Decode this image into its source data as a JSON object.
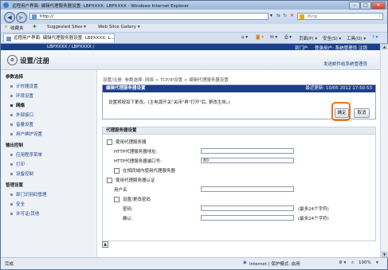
{
  "window": {
    "title": "远程用户界面: 编辑代理服务器设置: LBPXXXX: LBPXXXX - Windows Internet Explorer",
    "min": "–",
    "max": "□",
    "close": "✕"
  },
  "addressbar": {
    "url": "http://",
    "search_placeholder": "Bing"
  },
  "favorites": {
    "label": "收藏夹",
    "suggested": "Suggested Sites ▾",
    "gallery": "Web Slice Gallery ▾"
  },
  "tab": {
    "label": "远程用户界面: 编辑代理服务器设置: LBPXXXX: L..."
  },
  "commandbar": {
    "page": "页面(P) ▾",
    "safety": "安全(S) ▾",
    "tools": "工具(O) ▾"
  },
  "top": {
    "device": "LBPXXXX / LBPXXXX /",
    "portal": "到门户",
    "login": "登录用户: 系统管理员 注销"
  },
  "header": {
    "title": "设置/注册",
    "mail": "发送邮件给系统管理员"
  },
  "sidebar": {
    "sections": [
      {
        "title": "参数选择",
        "items": [
          "计时器设置",
          "环境设置",
          "网络",
          "外部接口",
          "音量设置",
          "用户维护设置"
        ]
      },
      {
        "title": "输出控制",
        "items": [
          "应用程序菜单",
          "打印",
          "设备控制"
        ]
      },
      {
        "title": "管理设置",
        "items": [
          "部门识别码管理",
          "安全",
          "许可证/其他"
        ]
      }
    ],
    "current": "网络"
  },
  "breadcrumb": "设置/注册: 参数选择: 网络 > TCP/IP设置 > 编辑代理服务器设置",
  "dialog": {
    "title": "编辑代理服务器设置",
    "updated": "最近更新: 10/05 2012 17:50:53",
    "note": "设置将按如下更改。(主电源开关\"关闭\"再\"打开\"后, 更改生效。)",
    "ok": "确定",
    "cancel": "取消"
  },
  "proxy": {
    "section_title": "代理服务器设置",
    "use_proxy": "使用代理服务器",
    "http_address_label": "HTTP代理服务器地址:",
    "http_address_value": "",
    "http_port_label": "HTTP代理服务器端口号:",
    "http_port_value": "80",
    "same_domain": "在相同域内使用代理服务器",
    "use_auth": "使用代理服务器认证",
    "username_label": "用户名",
    "username_value": "",
    "set_change_password": "设置/更改密码",
    "password_label": "密码:",
    "password_hint": "(最多24个字符)",
    "confirm_label": "确认:",
    "confirm_hint": "(最多24个字符)"
  },
  "status": {
    "left": "完成",
    "zone": "Internet | 保护模式: 启用",
    "zoom": "100%"
  }
}
